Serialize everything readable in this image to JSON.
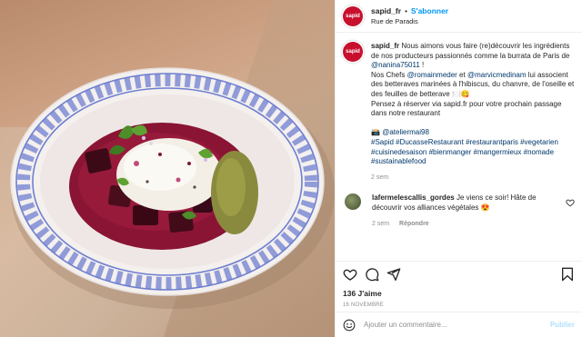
{
  "header": {
    "avatar_text": "sapid",
    "username": "sapid_fr",
    "separator": "•",
    "follow_label": "S'abonner",
    "location": "Rue de Paradis"
  },
  "caption": {
    "username": "sapid_fr",
    "line1": " Nous aimons vous faire (re)découvrir les ingrédients de nos producteurs passionnés comme la burrata de Paris de",
    "mention1": "@nanina75011",
    "line1_end": " !",
    "line2_start": "Nos Chefs ",
    "mention2": "@romainmeder",
    "line2_mid": " et ",
    "mention3": "@marvicmedinam",
    "line2_end": " lui associent des betteraves marinées à l'hibiscus, du chanvre, de l'oseille et des feuilles de betterave 🍽️😋",
    "line3": "Pensez à réserver via sapid.fr pour votre prochain passage dans notre restaurant",
    "camera_emoji": "📸",
    "mention4": "@ateliermai98",
    "hashtags": "#Sapid #DucasseRestaurant #restaurantparis #vegetarien #cuisinedesaison #bienmanger #mangermieux #nomade #sustainablefood",
    "time": "2 sem"
  },
  "comment": {
    "username": "lafermelescallis_gordes",
    "text": " Je viens ce soir! Hâte de découvrir vos alliances végétales 😍",
    "time": "2 sem",
    "reply_label": "Répondre"
  },
  "footer": {
    "likes": "136 J'aime",
    "date": "16 novembre",
    "add_comment_placeholder": "Ajouter un commentaire...",
    "publish_label": "Publier"
  },
  "icons": {
    "like": "heart-icon",
    "comment": "comment-icon",
    "share": "share-icon",
    "save": "bookmark-icon",
    "emoji": "emoji-icon"
  },
  "colors": {
    "accent": "#0095f6",
    "brand": "#c8102e",
    "link": "#00376b",
    "muted": "#8e8e8e",
    "publish_disabled": "#b2dffc"
  }
}
